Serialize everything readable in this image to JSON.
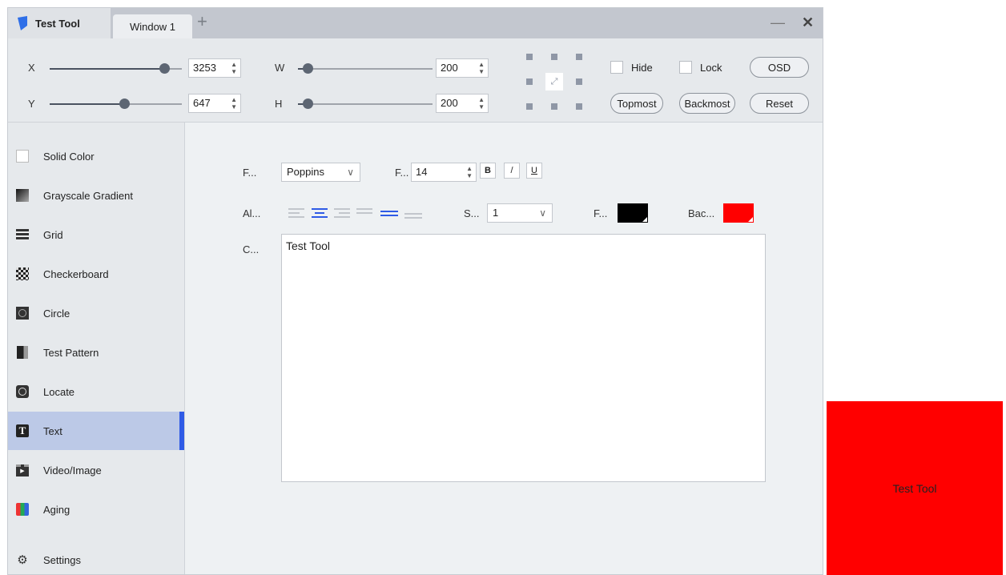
{
  "titlebar": {
    "app_title": "Test Tool",
    "tab": "Window 1",
    "new_tab": "+",
    "minimize": "—",
    "close": "✕"
  },
  "position": {
    "x_label": "X",
    "x_value": "3253",
    "y_label": "Y",
    "y_value": "647",
    "w_label": "W",
    "w_value": "200",
    "h_label": "H",
    "h_value": "200"
  },
  "options": {
    "hide": "Hide",
    "lock": "Lock",
    "osd": "OSD",
    "topmost": "Topmost",
    "backmost": "Backmost",
    "reset": "Reset"
  },
  "sidebar": {
    "items": [
      {
        "label": "Solid Color",
        "icon": "square-icon"
      },
      {
        "label": "Grayscale Gradient",
        "icon": "gradient-icon"
      },
      {
        "label": "Grid",
        "icon": "grid-icon"
      },
      {
        "label": "Checkerboard",
        "icon": "checkerboard-icon"
      },
      {
        "label": "Circle",
        "icon": "circle-icon"
      },
      {
        "label": "Test Pattern",
        "icon": "test-pattern-icon"
      },
      {
        "label": "Locate",
        "icon": "locate-icon"
      },
      {
        "label": "Text",
        "icon": "text-icon"
      },
      {
        "label": "Video/Image",
        "icon": "video-icon"
      },
      {
        "label": "Aging",
        "icon": "aging-icon"
      }
    ],
    "active": "Text",
    "settings": "Settings"
  },
  "text_panel": {
    "font_label": "F...",
    "font_value": "Poppins",
    "size_label": "F...",
    "size_value": "14",
    "bold": "B",
    "italic": "/",
    "underline": "U",
    "align_label": "Al...",
    "spacing_label": "S...",
    "spacing_value": "1",
    "fg_label": "F...",
    "fg_color": "#000000",
    "bg_label": "Bac...",
    "bg_color": "#ff0000",
    "content_label": "C...",
    "content_value": "Test Tool"
  },
  "preview": {
    "text": "Test Tool",
    "color": "#ff0000"
  }
}
